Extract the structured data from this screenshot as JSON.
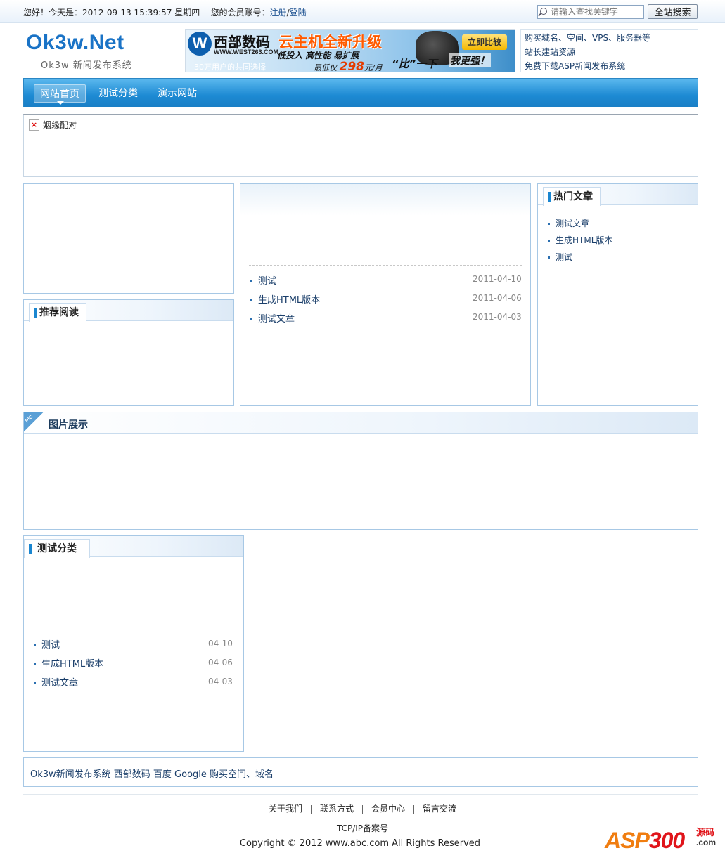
{
  "topbar": {
    "greeting": "您好！今天是：2012-09-13 15:39:57 星期四",
    "member_label": "您的会员账号：",
    "register": "注册",
    "slash": "/",
    "login": "登陆",
    "search_placeholder": "请输入查找关键字",
    "search_button": "全站搜索"
  },
  "header": {
    "logo": "Ok3w.Net",
    "logo_sub": "Ok3w 新闻发布系统"
  },
  "ad": {
    "brand_mark": "W",
    "brand": "西部数码",
    "site": "WWW.WEST263.COM",
    "slogan": "云主机全新升级",
    "features": "低投入  高性能  易扩展",
    "users": "30万用户的共同选择",
    "price_prefix": "最低仅",
    "price": "298",
    "price_suffix": "元/月",
    "compare": "立即比较",
    "bi": "“比”一下",
    "strong": "我更强！"
  },
  "right_links": [
    "购买域名、空间、VPS、服务器等",
    "站长建站资源",
    "免费下载ASP新闻发布系统"
  ],
  "nav": [
    "网站首页",
    "测试分类",
    "演示网站"
  ],
  "marriage": {
    "label": "姻缘配对",
    "broken_icon": "×"
  },
  "recommend": {
    "title": "推荐阅读"
  },
  "center_list": [
    {
      "title": "测试",
      "date": "2011-04-10"
    },
    {
      "title": "生成HTML版本",
      "date": "2011-04-06"
    },
    {
      "title": "测试文章",
      "date": "2011-04-03"
    }
  ],
  "hot": {
    "title": "热门文章",
    "items": [
      "测试文章",
      "生成HTML版本",
      "测试"
    ]
  },
  "pictures": {
    "title": "图片展示",
    "ribbon": "PIC"
  },
  "category": {
    "title": "测试分类",
    "items": [
      {
        "title": "测试",
        "date": "04-10"
      },
      {
        "title": "生成HTML版本",
        "date": "04-06"
      },
      {
        "title": "测试文章",
        "date": "04-03"
      }
    ]
  },
  "friend_links": "Ok3w新闻发布系统 西部数码 百度 Google 购买空间、域名",
  "bottom_nav": [
    "关于我们",
    "联系方式",
    "会员中心",
    "留言交流"
  ],
  "icp": "TCP/IP备案号",
  "copyright": "Copyright © 2012 www.abc.com All Rights Reserved",
  "watermark": {
    "asp": "ASP",
    "num": "300",
    "yuanma": "源码",
    "com": ".com"
  }
}
